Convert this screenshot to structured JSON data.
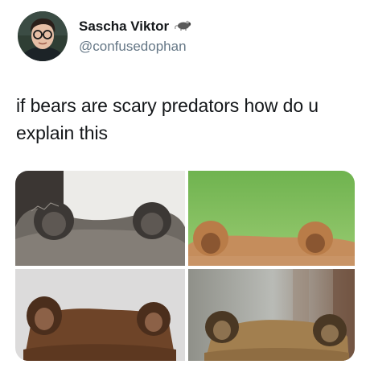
{
  "tweet": {
    "display_name": "Sascha Viktor",
    "handle": "@confusedophan",
    "badge_icon": "rat-emoji-icon",
    "text": "if bears are scary predators how do u explain this",
    "avatar_icon": "profile-photo-person-with-glasses",
    "media": [
      {
        "description_icon": "bear-ears-photo-1",
        "bg": "#e9e7e5",
        "fur": "#6f6a63"
      },
      {
        "description_icon": "bear-ears-photo-2",
        "bg": "#7fbf5a",
        "fur": "#c28a5a"
      },
      {
        "description_icon": "bear-ears-photo-3",
        "bg": "#dcdcdc",
        "fur": "#6b4327"
      },
      {
        "description_icon": "bear-ears-photo-4",
        "bg": "#9fa2a0",
        "fur": "#8b6a40"
      }
    ]
  }
}
